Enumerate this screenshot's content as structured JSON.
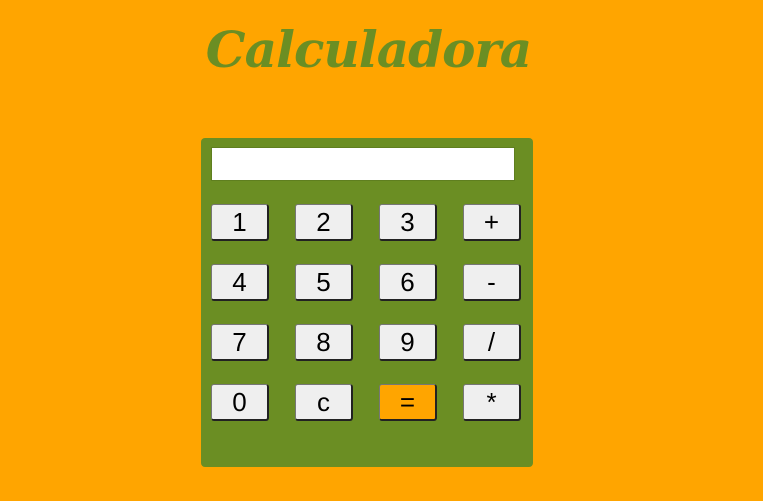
{
  "page": {
    "title": "Calculadora",
    "background_color": "#FFA500",
    "accent_color": "#6B8E23"
  },
  "calculator": {
    "display": {
      "value": ""
    },
    "keys": [
      {
        "label": "1"
      },
      {
        "label": "2"
      },
      {
        "label": "3"
      },
      {
        "label": "+"
      },
      {
        "label": "4"
      },
      {
        "label": "5"
      },
      {
        "label": "6"
      },
      {
        "label": "-"
      },
      {
        "label": "7"
      },
      {
        "label": "8"
      },
      {
        "label": "9"
      },
      {
        "label": "/"
      },
      {
        "label": "0"
      },
      {
        "label": "c"
      },
      {
        "label": "="
      },
      {
        "label": "*"
      }
    ]
  }
}
